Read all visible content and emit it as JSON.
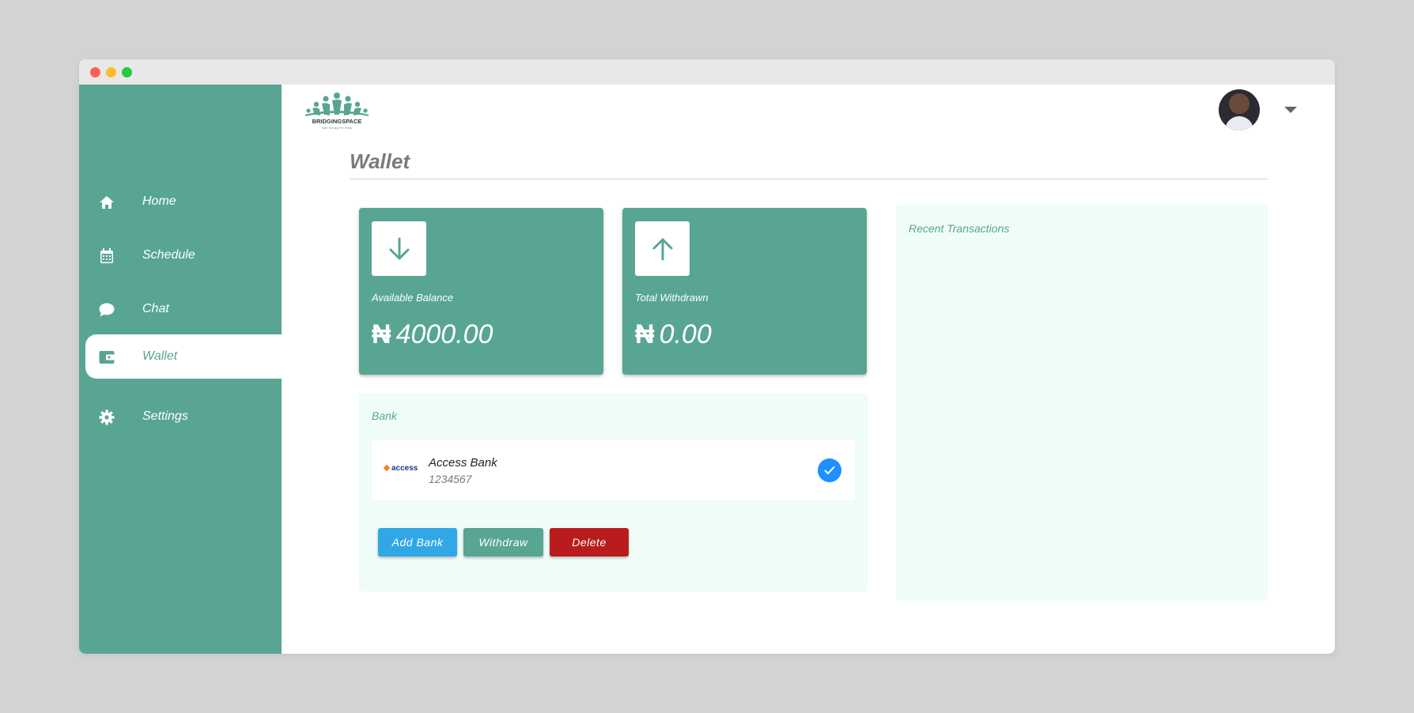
{
  "window": {
    "controls": [
      "close",
      "minimize",
      "maximize"
    ]
  },
  "brand": {
    "name": "BRIDGINGSPACE",
    "tagline": "Safe Therapy For Today",
    "icon": "bridgingspace-logo"
  },
  "sidebar": {
    "items": [
      {
        "label": "Home",
        "icon": "home-icon",
        "active": false
      },
      {
        "label": "Schedule",
        "icon": "calendar-icon",
        "active": false
      },
      {
        "label": "Chat",
        "icon": "chat-bubble-icon",
        "active": false
      },
      {
        "label": "Wallet",
        "icon": "wallet-icon",
        "active": true
      },
      {
        "label": "Settings",
        "icon": "gear-icon",
        "active": false
      }
    ]
  },
  "header": {
    "avatar": "user-avatar",
    "menu_icon": "chevron-down-icon"
  },
  "page": {
    "title": "Wallet"
  },
  "stats": [
    {
      "label": "Available Balance",
      "currency": "₦",
      "value": "4000.00",
      "icon": "arrow-down-icon"
    },
    {
      "label": "Total Withdrawn",
      "currency": "₦",
      "value": "0.00",
      "icon": "arrow-up-icon"
    }
  ],
  "bank": {
    "title": "Bank",
    "account": {
      "logo_text": "access",
      "name": "Access Bank",
      "number": "1234567",
      "selected": true
    },
    "buttons": {
      "add": "Add Bank",
      "withdraw": "Withdraw",
      "delete": "Delete"
    }
  },
  "transactions": {
    "title": "Recent Transactions"
  },
  "colors": {
    "primary": "#58a594",
    "panel_bg": "#effcf8",
    "add_button": "#32a7e6",
    "delete_button": "#b91c1c",
    "check": "#1e90ff"
  }
}
